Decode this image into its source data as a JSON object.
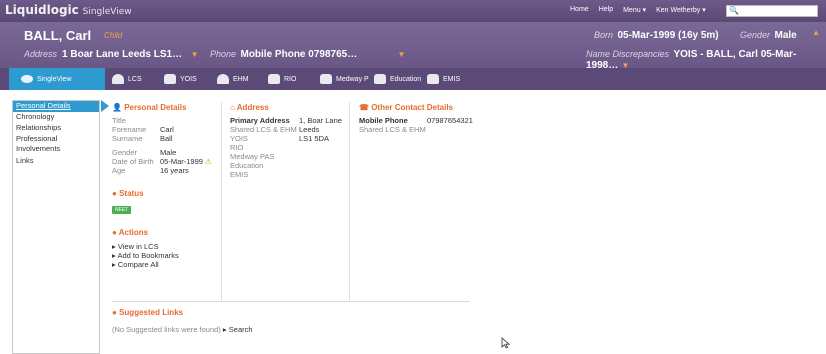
{
  "brand": {
    "name": "Liquidlogic",
    "product": "SingleView"
  },
  "topnav": [
    "Home",
    "Help",
    "Menu ▾",
    "Ken Wetherby ▾"
  ],
  "patient": {
    "name": "BALL, Carl",
    "child_label": "Child",
    "address_label": "Address",
    "address_value": "1 Boar Lane Leeds LS1…",
    "phone_label": "Phone",
    "phone_value": "Mobile Phone 0798765…",
    "born_label": "Born",
    "born_value": "05-Mar-1999 (16y 5m)",
    "gender_label": "Gender",
    "gender_value": "Male",
    "namedisc_label": "Name Discrepancies",
    "namedisc_value": "YOIS - BALL, Carl 05-Mar-1998…"
  },
  "tabs": [
    {
      "label": "SingleView"
    },
    {
      "label": "LCS"
    },
    {
      "label": "YOIS"
    },
    {
      "label": "EHM"
    },
    {
      "label": "RIO"
    },
    {
      "label": "Medway P"
    },
    {
      "label": "Education"
    },
    {
      "label": "EMIS"
    }
  ],
  "sidebar": [
    {
      "label": "Personal Details"
    },
    {
      "label": "Chronology"
    },
    {
      "label": "Relationships"
    },
    {
      "label": "Professional Involvements"
    },
    {
      "label": "Links"
    }
  ],
  "personal": {
    "heading": "Personal Details",
    "title_k": "Title",
    "title_v": "",
    "forename_k": "Forename",
    "forename_v": "Carl",
    "surname_k": "Surname",
    "surname_v": "Ball",
    "gender_k": "Gender",
    "gender_v": "Male",
    "dob_k": "Date of Birth",
    "dob_v": "05-Mar-1999",
    "age_k": "Age",
    "age_v": "16 years"
  },
  "status": {
    "heading": "Status",
    "badge": "NEET"
  },
  "actions": {
    "heading": "Actions",
    "items": [
      "View in LCS",
      "Add to Bookmarks",
      "Compare All"
    ]
  },
  "address": {
    "heading": "Address",
    "primary_label": "Primary Address",
    "primary_value": "1, Boar Lane",
    "shared_label": "Shared LCS & EHM",
    "line2": "Leeds",
    "yois": "YOIS",
    "postcode": "LS1 5DA",
    "sources": [
      "RIO",
      "Medway PAS",
      "Education",
      "EMIS"
    ]
  },
  "contact": {
    "heading": "Other Contact Details",
    "mobile_label": "Mobile Phone",
    "mobile_value": "07987654321",
    "shared_label": "Shared LCS & EHM"
  },
  "suggested": {
    "heading": "Suggested Links",
    "text": "(No Suggested links were found)",
    "search_label": "Search"
  }
}
